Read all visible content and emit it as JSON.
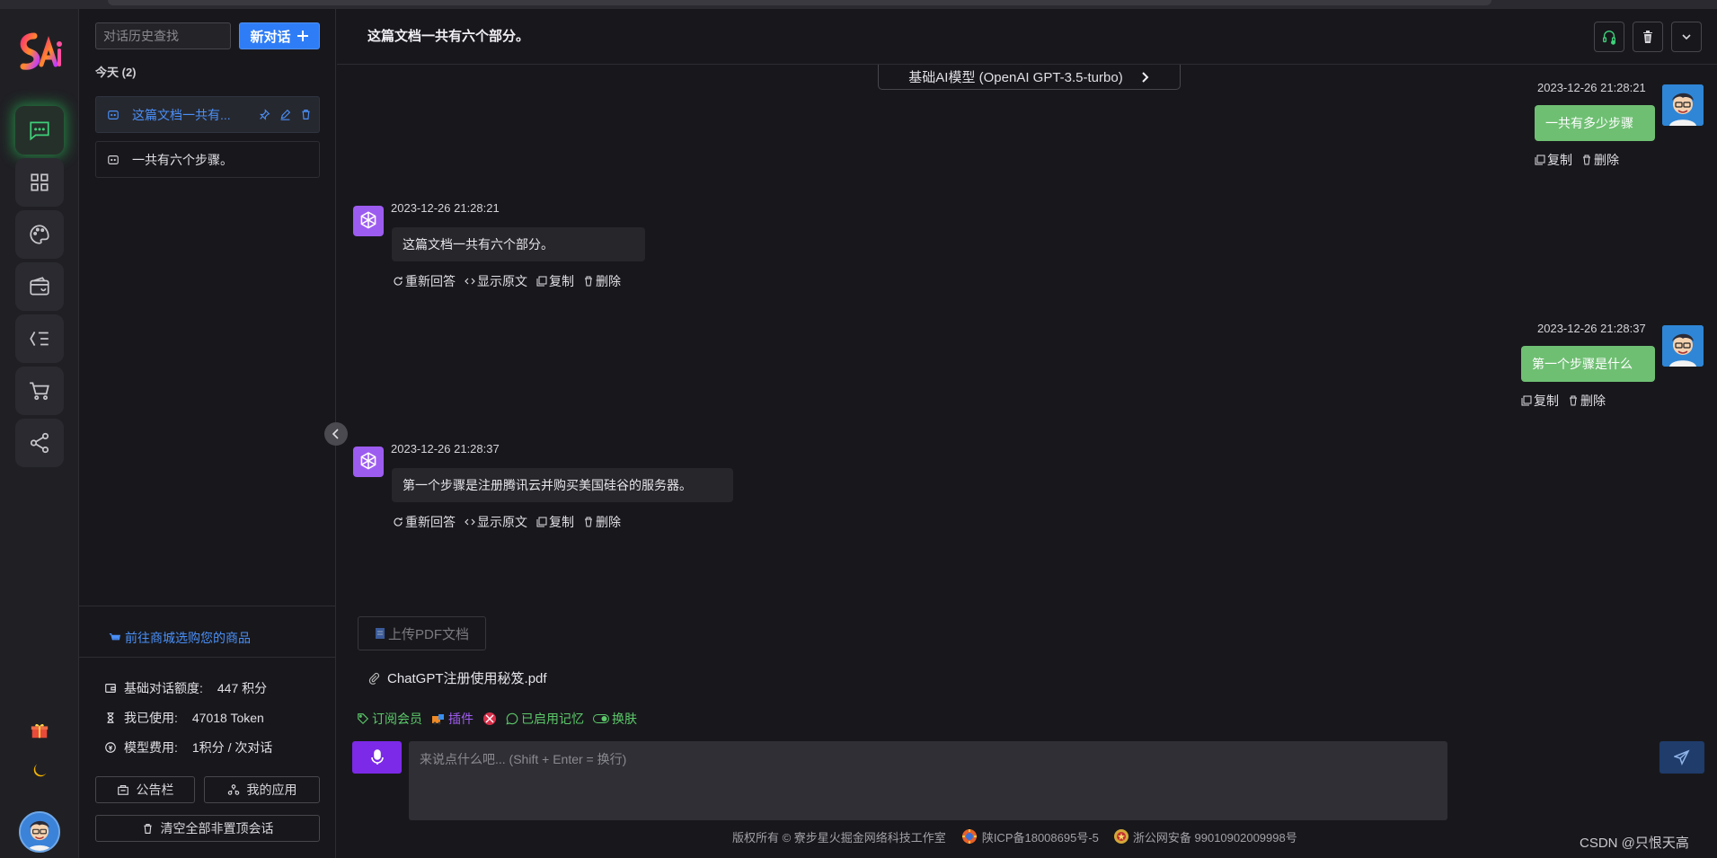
{
  "sidebar": {
    "search_placeholder": "对话历史查找",
    "new_chat_label": "新对话",
    "today_label": "今天 (2)",
    "items": [
      {
        "label": "这篇文档一共有..."
      },
      {
        "label": "一共有六个步骤。"
      }
    ],
    "shop_link": "前往商城选购您的商品",
    "stats": [
      {
        "label": "基础对话额度:",
        "value": "447 积分"
      },
      {
        "label": "我已使用:",
        "value": "47018 Token"
      },
      {
        "label": "模型费用:",
        "value": "1积分 / 次对话"
      }
    ],
    "notice_btn": "公告栏",
    "apps_btn": "我的应用",
    "clear_btn": "清空全部非置顶会话"
  },
  "header": {
    "title": "这篇文档一共有六个部分。"
  },
  "model_selector": "基础AI模型 (OpenAI GPT-3.5-turbo)",
  "messages": [
    {
      "role": "user",
      "time": "2023-12-26 21:28:21",
      "text": "一共有多少步骤",
      "actions": [
        "复制",
        "删除"
      ]
    },
    {
      "role": "ai",
      "time": "2023-12-26 21:28:21",
      "text": "这篇文档一共有六个部分。",
      "actions": [
        "重新回答",
        "显示原文",
        "复制",
        "删除"
      ]
    },
    {
      "role": "user",
      "time": "2023-12-26 21:28:37",
      "text": "第一个步骤是什么",
      "actions": [
        "复制",
        "删除"
      ]
    },
    {
      "role": "ai",
      "time": "2023-12-26 21:28:37",
      "text": "第一个步骤是注册腾讯云并购买美国硅谷的服务器。",
      "actions": [
        "重新回答",
        "显示原文",
        "复制",
        "删除"
      ]
    }
  ],
  "composer": {
    "upload_label": "上传PDF文档",
    "file_name": "ChatGPT注册使用秘笈.pdf",
    "toolbar": {
      "subscribe": "订阅会员",
      "plugin": "插件",
      "memory": "已启用记忆",
      "theme": "换肤"
    },
    "placeholder": "来说点什么吧... (Shift + Enter = 换行)"
  },
  "footer": {
    "copyright": "版权所有 © 寮步星火掘金网络科技工作室",
    "icp": "陕ICP备18008695号-5",
    "police": "浙公网安备 99010902009998号"
  },
  "watermark": "CSDN @只恨天高",
  "colors": {
    "accent": "#2f7df6",
    "user_bubble": "#6fbf73",
    "ai_avatar": "#9d5cf0",
    "mic": "#7c2ae8"
  }
}
